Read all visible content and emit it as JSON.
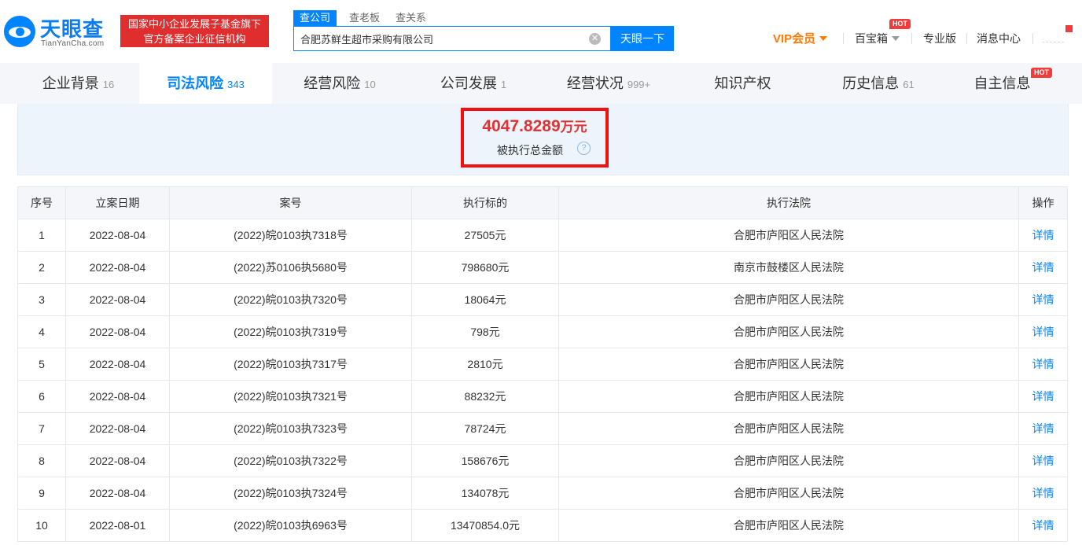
{
  "header": {
    "logo_name": "天眼查",
    "logo_domain": "TianYanCha.com",
    "badge_line1": "国家中小企业发展子基金旗下",
    "badge_line2": "官方备案企业征信机构",
    "search_tabs": [
      "查公司",
      "查老板",
      "查关系"
    ],
    "search_value": "合肥苏鲜生超市采购有限公司",
    "search_button": "天眼一下",
    "nav": {
      "vip": "VIP会员",
      "treasure": "百宝箱",
      "hot": "HOT",
      "pro": "专业版",
      "messages": "消息中心"
    }
  },
  "tabs": [
    {
      "label": "企业背景",
      "count": "16"
    },
    {
      "label": "司法风险",
      "count": "343"
    },
    {
      "label": "经营风险",
      "count": "10"
    },
    {
      "label": "公司发展",
      "count": "1"
    },
    {
      "label": "经营状况",
      "count": "999+"
    },
    {
      "label": "知识产权",
      "count": ""
    },
    {
      "label": "历史信息",
      "count": "61"
    },
    {
      "label": "自主信息",
      "count": "",
      "hot": "HOT"
    }
  ],
  "summary": {
    "amount": "4047.8289",
    "unit": "万元",
    "label": "被执行总金额",
    "help": "?"
  },
  "table": {
    "headers": [
      "序号",
      "立案日期",
      "案号",
      "执行标的",
      "执行法院",
      "操作"
    ],
    "rows": [
      [
        "1",
        "2022-08-04",
        "(2022)皖0103执7318号",
        "27505元",
        "合肥市庐阳区人民法院",
        "详情"
      ],
      [
        "2",
        "2022-08-04",
        "(2022)苏0106执5680号",
        "798680元",
        "南京市鼓楼区人民法院",
        "详情"
      ],
      [
        "3",
        "2022-08-04",
        "(2022)皖0103执7320号",
        "18064元",
        "合肥市庐阳区人民法院",
        "详情"
      ],
      [
        "4",
        "2022-08-04",
        "(2022)皖0103执7319号",
        "798元",
        "合肥市庐阳区人民法院",
        "详情"
      ],
      [
        "5",
        "2022-08-04",
        "(2022)皖0103执7317号",
        "2810元",
        "合肥市庐阳区人民法院",
        "详情"
      ],
      [
        "6",
        "2022-08-04",
        "(2022)皖0103执7321号",
        "88232元",
        "合肥市庐阳区人民法院",
        "详情"
      ],
      [
        "7",
        "2022-08-04",
        "(2022)皖0103执7323号",
        "78724元",
        "合肥市庐阳区人民法院",
        "详情"
      ],
      [
        "8",
        "2022-08-04",
        "(2022)皖0103执7322号",
        "158676元",
        "合肥市庐阳区人民法院",
        "详情"
      ],
      [
        "9",
        "2022-08-04",
        "(2022)皖0103执7324号",
        "134078元",
        "合肥市庐阳区人民法院",
        "详情"
      ],
      [
        "10",
        "2022-08-01",
        "(2022)皖0103执6963号",
        "13470854.0元",
        "合肥市庐阳区人民法院",
        "详情"
      ]
    ]
  },
  "colors": {
    "brand": "#0084ff",
    "badge": "#e02d2d",
    "vip": "#ff7a00",
    "highlight": "#f01010",
    "amount": "#e03434"
  }
}
